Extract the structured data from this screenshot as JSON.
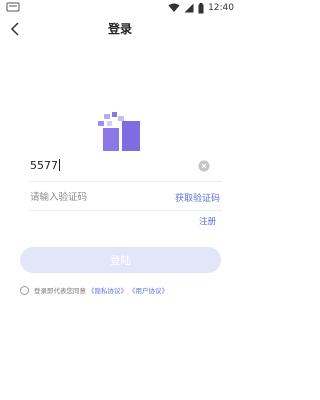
{
  "status_bar": {
    "time": "12:40",
    "icons": [
      "wifi-icon",
      "signal-icon",
      "battery-icon"
    ]
  },
  "nav": {
    "title": "登录",
    "back_icon": "chevron-left-icon"
  },
  "login_form": {
    "phone_value": "5577",
    "code_placeholder": "请输入验证码",
    "get_code_label": "获取验证码",
    "register_label": "注册",
    "login_button_label": "登陆"
  },
  "agreement": {
    "text": "登录即代表您同意",
    "privacy_link": "《隐私协议》",
    "user_link": "《用户协议》",
    "checked": false
  },
  "colors": {
    "accent": "#5d6fd6",
    "logo_purple": "#8b78e6",
    "button_disabled_bg": "#e3e6f8"
  }
}
